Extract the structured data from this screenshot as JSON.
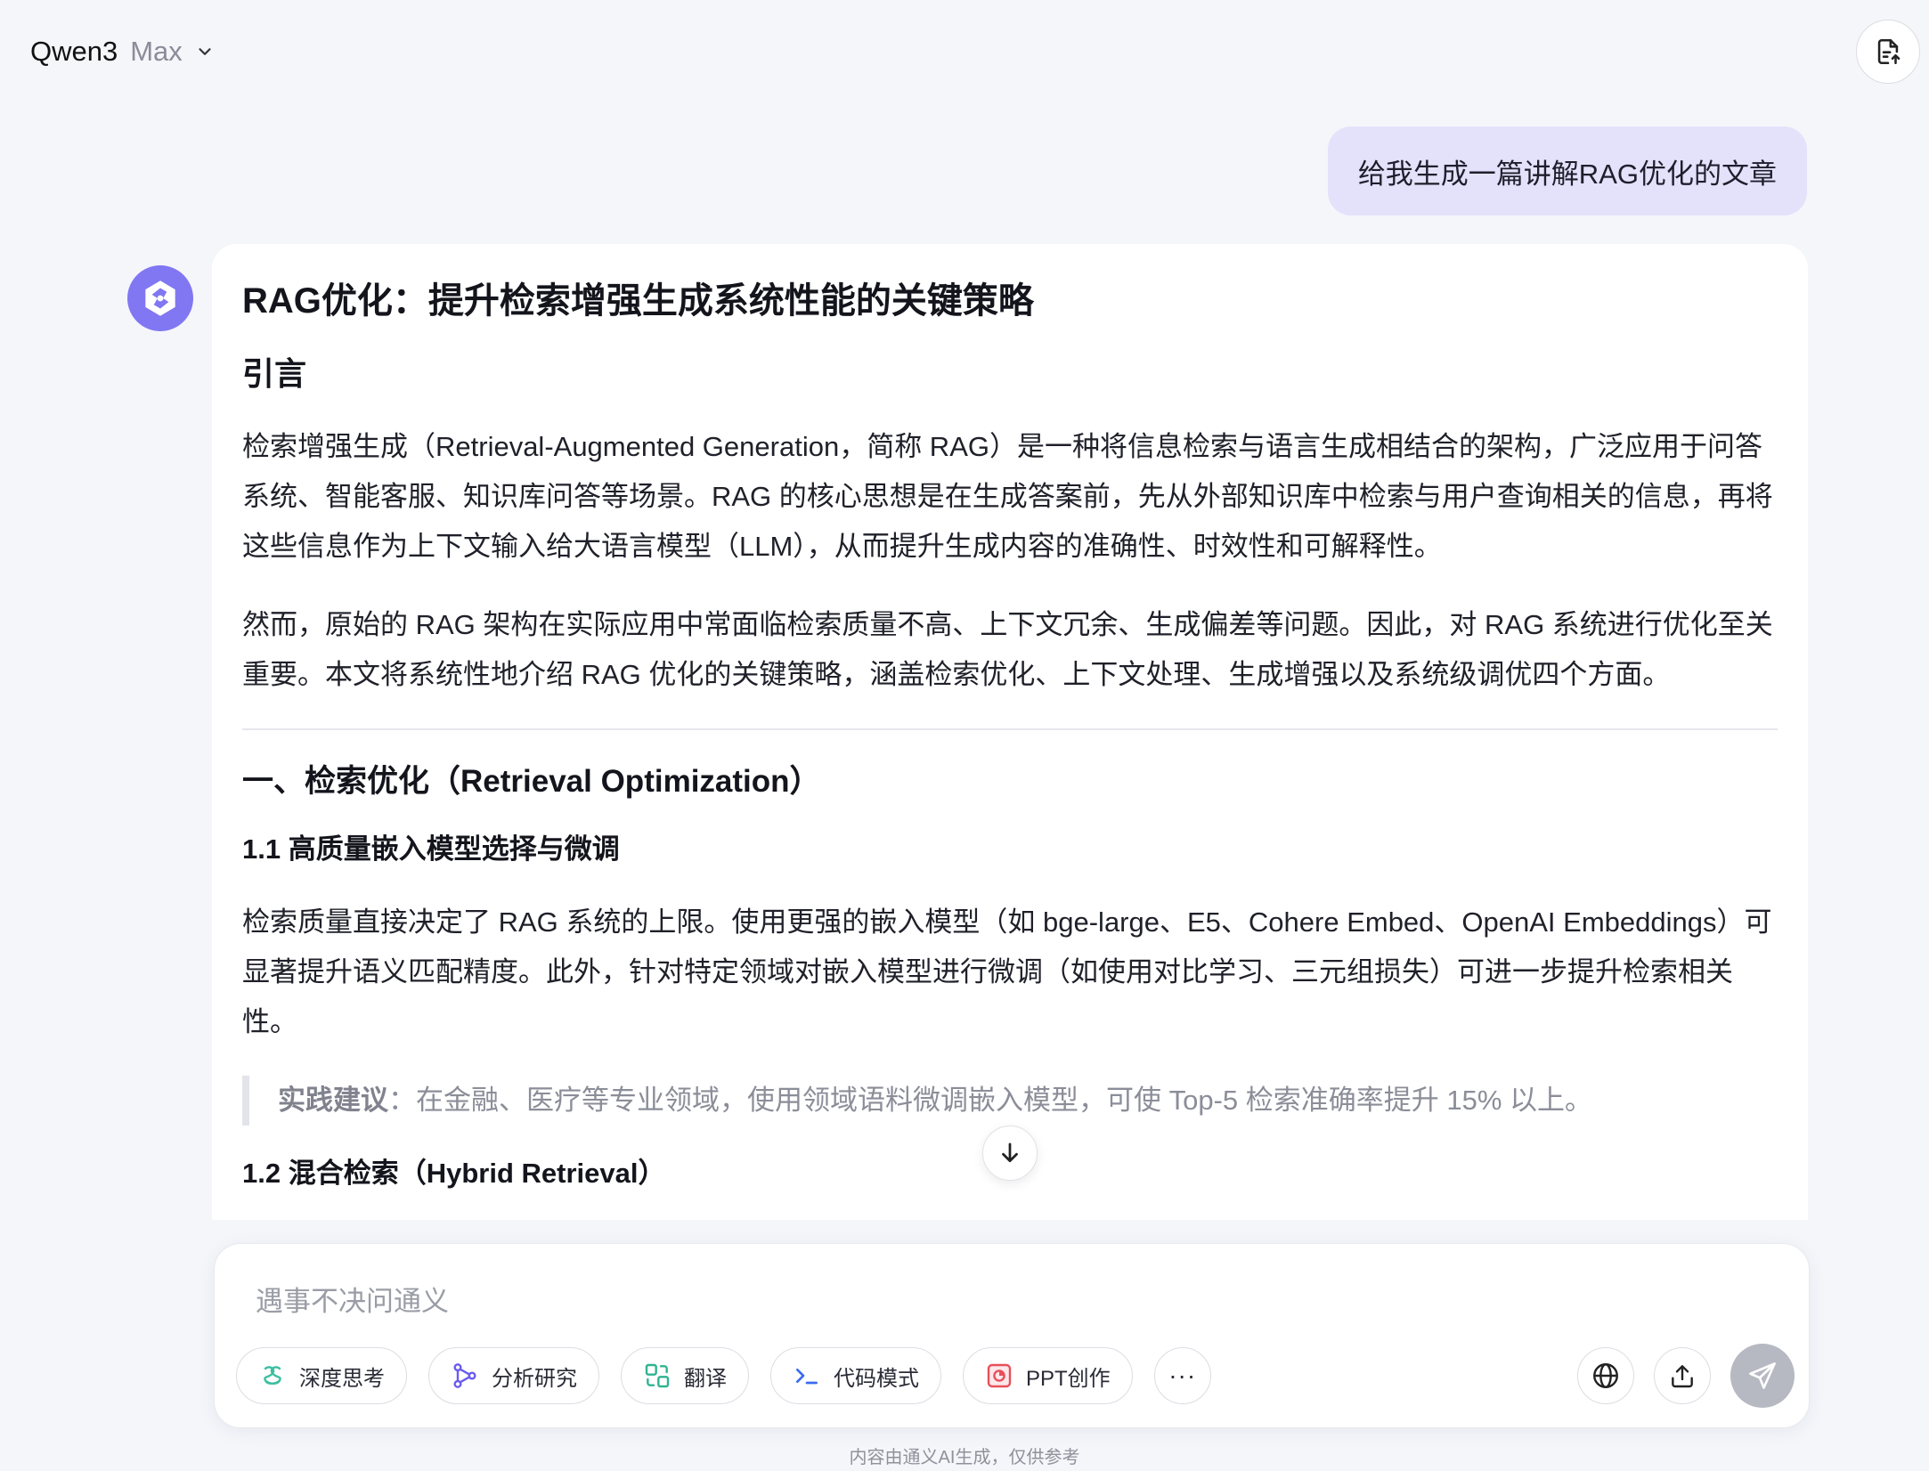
{
  "header": {
    "model_name": "Qwen3",
    "model_variant": "Max"
  },
  "user_message": "给我生成一篇讲解RAG优化的文章",
  "answer": {
    "title": "RAG优化：提升检索增强生成系统性能的关键策略",
    "intro_heading": "引言",
    "intro_p1": "检索增强生成（Retrieval-Augmented Generation，简称 RAG）是一种将信息检索与语言生成相结合的架构，广泛应用于问答系统、智能客服、知识库问答等场景。RAG 的核心思想是在生成答案前，先从外部知识库中检索与用户查询相关的信息，再将这些信息作为上下文输入给大语言模型（LLM），从而提升生成内容的准确性、时效性和可解释性。",
    "intro_p2": "然而，原始的 RAG 架构在实际应用中常面临检索质量不高、上下文冗余、生成偏差等问题。因此，对 RAG 系统进行优化至关重要。本文将系统性地介绍 RAG 优化的关键策略，涵盖检索优化、上下文处理、生成增强以及系统级调优四个方面。",
    "section1_heading": "一、检索优化（Retrieval Optimization）",
    "sub11_heading": "1.1 高质量嵌入模型选择与微调",
    "sub11_p": "检索质量直接决定了 RAG 系统的上限。使用更强的嵌入模型（如 bge-large、E5、Cohere Embed、OpenAI Embeddings）可显著提升语义匹配精度。此外，针对特定领域对嵌入模型进行微调（如使用对比学习、三元组损失）可进一步提升检索相关性。",
    "tip_label": "实践建议",
    "tip_sep": "：",
    "tip_text": "在金融、医疗等专业领域，使用领域语料微调嵌入模型，可使 Top-5 检索准确率提升 15% 以上。",
    "sub12_heading": "1.2 混合检索（Hybrid Retrieval）"
  },
  "composer": {
    "placeholder": "遇事不决问通义",
    "tools": {
      "deep_think": "深度思考",
      "research": "分析研究",
      "translate": "翻译",
      "code_mode": "代码模式",
      "ppt": "PPT创作",
      "more": "···"
    }
  },
  "footer_note": "内容由通义AI生成，仅供参考",
  "colors": {
    "accent": "#8177f2",
    "user_bubble": "#e4e2fb",
    "send_disabled": "#b6b8c2",
    "deep_think_icon": "#3cbfa0",
    "research_icon": "#6a5cf0",
    "translate_icon": "#2fb390",
    "code_icon": "#3d6bf0",
    "ppt_icon": "#e8505b"
  },
  "icons": {
    "model_dropdown": "chevron-down-icon",
    "header_action": "document-upload-icon",
    "avatar": "qwen-logo-icon",
    "scroll": "arrow-down-icon",
    "web_search": "globe-icon",
    "upload": "upload-icon",
    "send": "paper-plane-icon"
  }
}
